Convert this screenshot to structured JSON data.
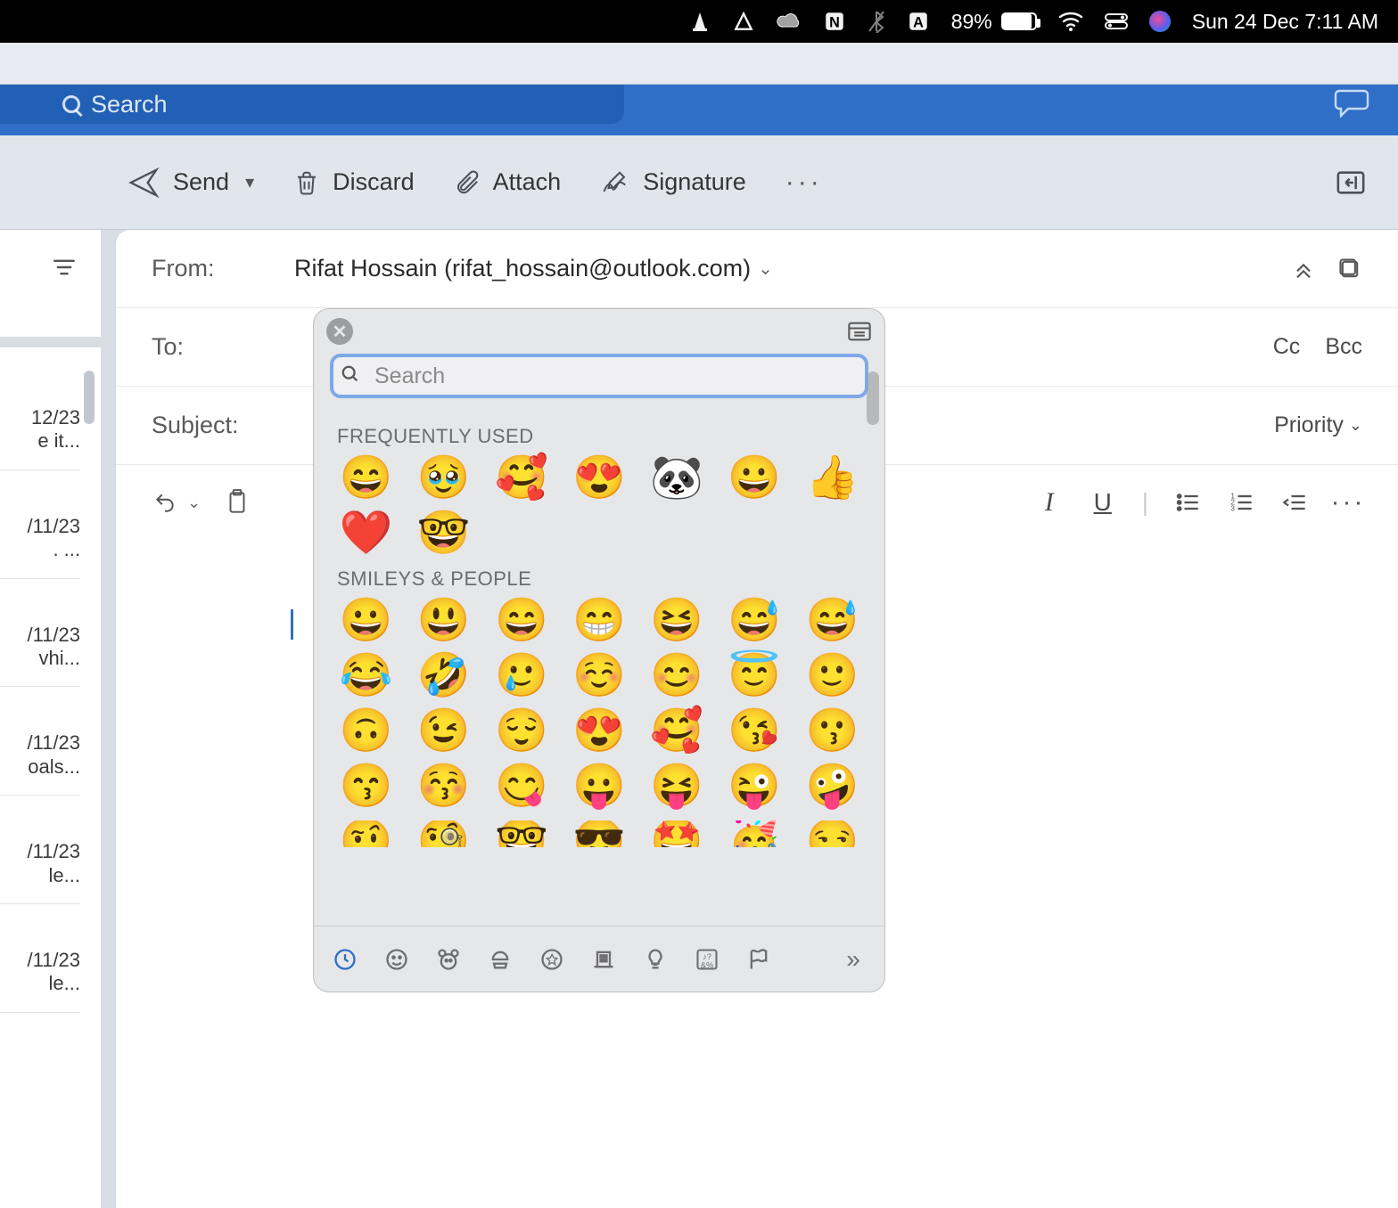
{
  "menubar": {
    "battery_pct": "89%",
    "date_time": "Sun 24 Dec  7:11 AM"
  },
  "header": {
    "search_placeholder": "Search"
  },
  "toolbar": {
    "send": "Send",
    "discard": "Discard",
    "attach": "Attach",
    "signature": "Signature"
  },
  "compose": {
    "from_label": "From:",
    "from_value": "Rifat Hossain (rifat_hossain@outlook.com)",
    "to_label": "To:",
    "cc": "Cc",
    "bcc": "Bcc",
    "subject_label": "Subject:",
    "priority": "Priority"
  },
  "mail_preview": [
    {
      "date": "12/23",
      "snip": "e it..."
    },
    {
      "date": "/11/23",
      "snip": ".   ..."
    },
    {
      "date": "/11/23",
      "snip": "vhi..."
    },
    {
      "date": "/11/23",
      "snip": "oals..."
    },
    {
      "date": "/11/23",
      "snip": "le..."
    },
    {
      "date": "/11/23",
      "snip": "le..."
    }
  ],
  "picker": {
    "search_placeholder": "Search",
    "freq_label": "FREQUENTLY USED",
    "smileys_label": "SMILEYS & PEOPLE",
    "freq": [
      "😄",
      "🥹",
      "🥰",
      "😍",
      "🐼",
      "😀",
      "👍",
      "❤️",
      "🤓"
    ],
    "smileys": [
      "😀",
      "😃",
      "😄",
      "😁",
      "😆",
      "😅",
      "😅",
      "😂",
      "🤣",
      "🥲",
      "☺️",
      "😊",
      "😇",
      "🙂",
      "🙃",
      "😉",
      "😌",
      "😍",
      "🥰",
      "😘",
      "😗",
      "😙",
      "😚",
      "😋",
      "😛",
      "😝",
      "😜",
      "🤪",
      "🤨",
      "🧐",
      "🤓",
      "😎",
      "🤩",
      "🥳",
      "😏"
    ]
  }
}
